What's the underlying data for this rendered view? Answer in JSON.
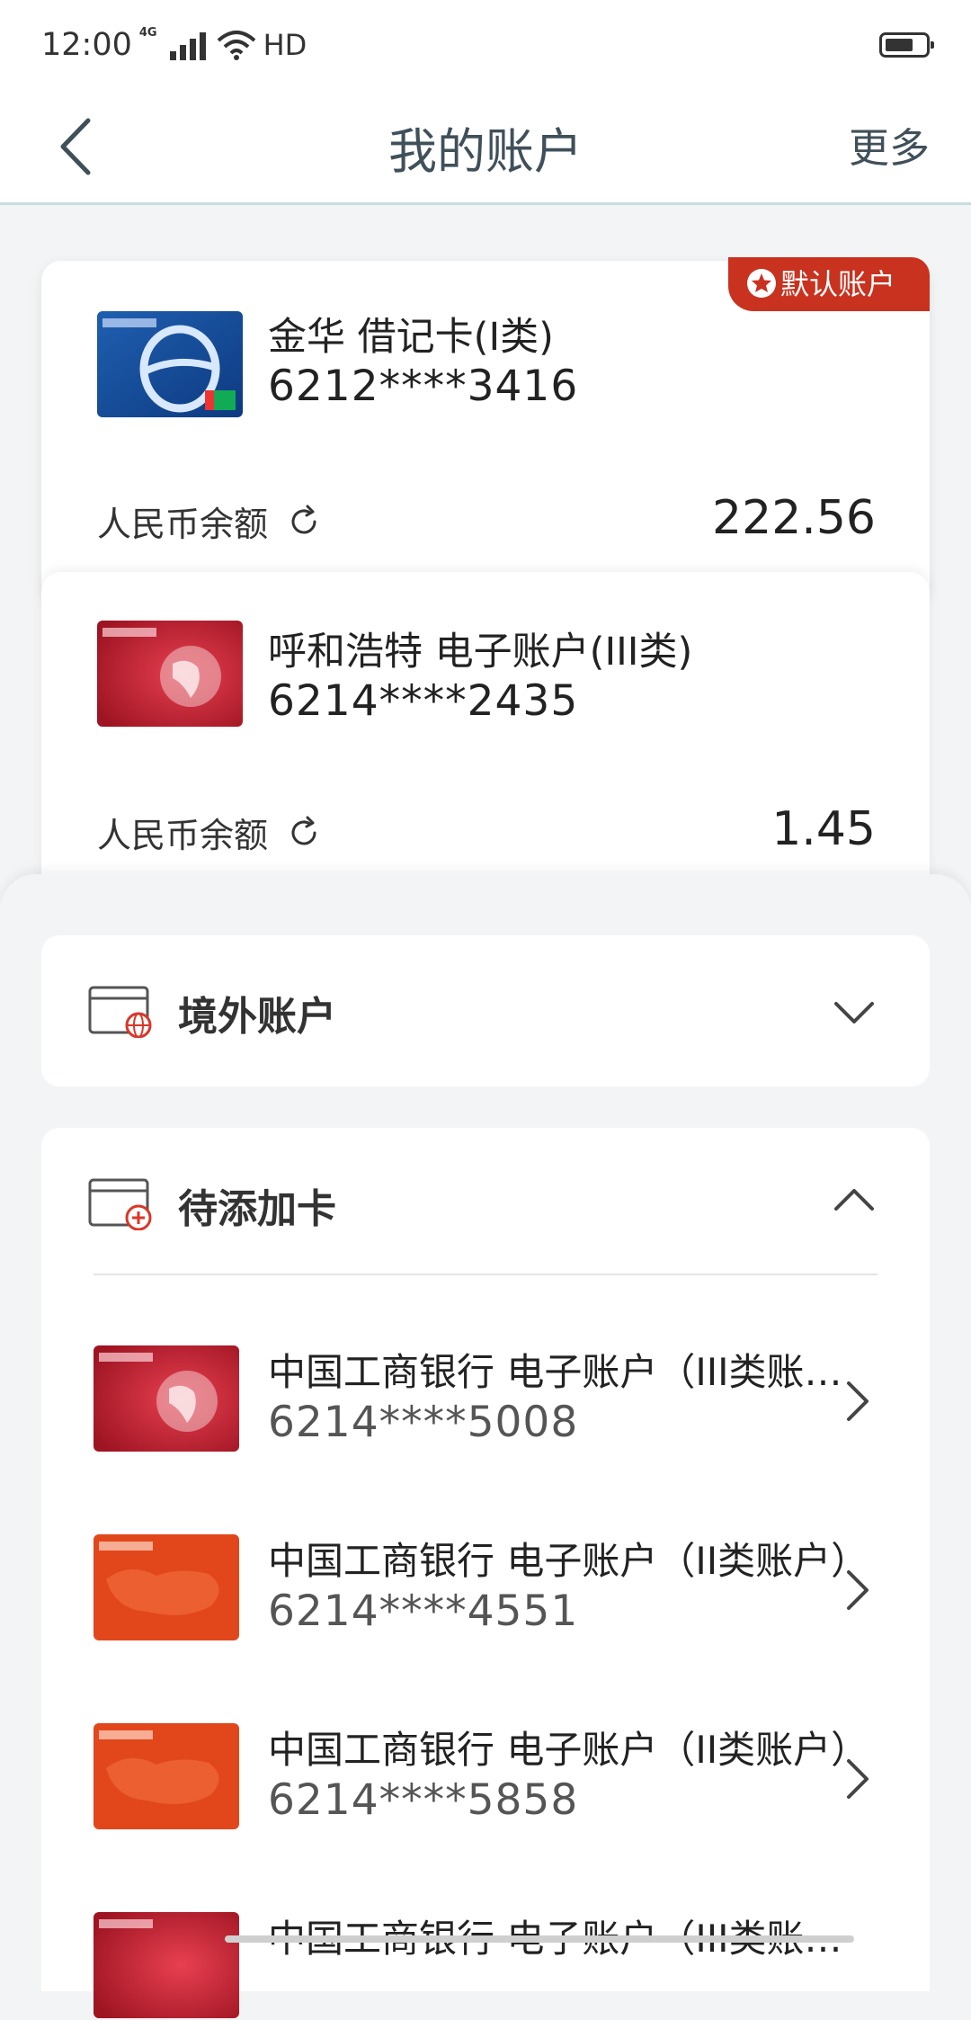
{
  "status_bar": {
    "time": "12:00",
    "network": "4G",
    "extra": "HD"
  },
  "nav": {
    "title": "我的账户",
    "more": "更多"
  },
  "accounts": [
    {
      "badge": "默认账户",
      "name": "金华 借记卡(I类)",
      "number": "6212****3416",
      "balance_label": "人民币余额",
      "balance": "222.56",
      "thumb_style": "blue"
    },
    {
      "name": "呼和浩特 电子账户(III类)",
      "number": "6214****2435",
      "balance_label": "人民币余额",
      "balance": "1.45",
      "thumb_style": "red"
    }
  ],
  "overseas": {
    "title": "境外账户",
    "state": "collapsed"
  },
  "pending": {
    "title": "待添加卡",
    "state": "expanded",
    "items": [
      {
        "name": "中国工商银行  电子账户（III类账户）",
        "number": "6214****5008",
        "thumb_style": "red"
      },
      {
        "name": "中国工商银行  电子账户（II类账户）",
        "number": "6214****4551",
        "thumb_style": "orange"
      },
      {
        "name": "中国工商银行  电子账户（II类账户）",
        "number": "6214****5858",
        "thumb_style": "orange"
      },
      {
        "name": "中国工商银行  电子账户（III类账户）",
        "number": "",
        "thumb_style": "red"
      }
    ]
  },
  "colors": {
    "badge_red": "#c8321f",
    "nav_text": "#40505a",
    "background": "#f3f4f5"
  }
}
